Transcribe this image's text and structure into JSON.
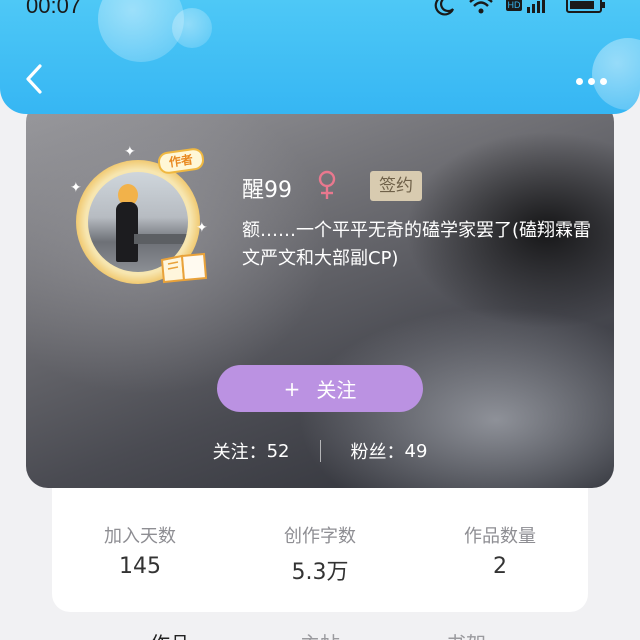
{
  "status_bar": {
    "time": "00:07",
    "icons": [
      "moon-icon",
      "wifi-icon",
      "hd-icon",
      "signal-icon",
      "battery-icon"
    ]
  },
  "header": {
    "back_icon": "chevron-left-icon",
    "more_icon": "more-horizontal-icon",
    "color": "#3fbcf5"
  },
  "profile": {
    "author_badge": "作者",
    "nickname": "醒99",
    "gender": "female",
    "gender_color": "#e9788e",
    "signed_badge": "签约",
    "bio": "额……一个平平无奇的磕学家罢了(磕翔霖雷文严文和大部副CP)",
    "follow_button": "关注",
    "follow_button_color": "#bb92e2",
    "following_label": "关注：",
    "following_count": "52",
    "fans_label": "粉丝：",
    "fans_count": "49"
  },
  "info": {
    "days_label": "加入天数",
    "days_value": "145",
    "words_label": "创作字数",
    "words_value": "5.3万",
    "works_label": "作品数量",
    "works_value": "2"
  },
  "tabs": [
    {
      "label": "作品"
    },
    {
      "label": "主帖"
    },
    {
      "label": "书架"
    }
  ]
}
